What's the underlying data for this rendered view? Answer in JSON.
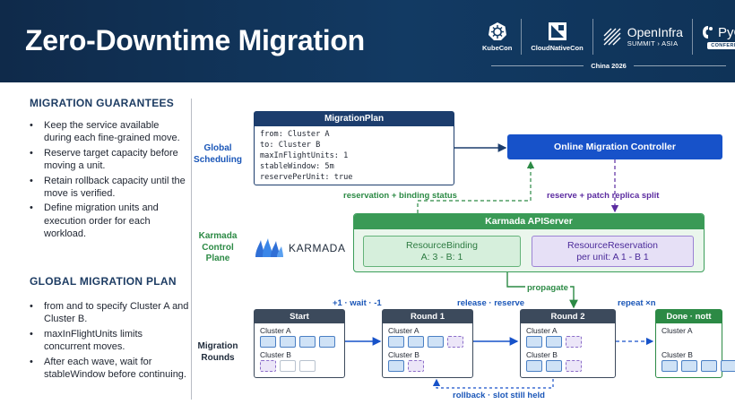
{
  "header": {
    "title": "Zero-Downtime Migration",
    "logos": {
      "kubecon": "KubeCon",
      "cloudnativecon": "CloudNativeCon",
      "openinfra_name": "OpenInfra",
      "openinfra_sub": "SUMMIT › ASIA",
      "pycon_name": "PyCon",
      "pycon_sub": "CONFERENCE",
      "event": "China 2026"
    }
  },
  "left": {
    "guarantees": {
      "heading": "MIGRATION GUARANTEES",
      "items": [
        "Keep the service available during each fine-grained move.",
        "Reserve target capacity before moving a unit.",
        "Retain rollback capacity until the move is verified.",
        "Define migration units and execution order for each workload."
      ]
    },
    "plan": {
      "heading": "GLOBAL MIGRATION PLAN",
      "items": [
        "from and to specify Cluster A and Cluster B.",
        "maxInFlightUnits limits concurrent moves.",
        "After each wave, wait for stableWindow before continuing."
      ]
    }
  },
  "diagram": {
    "rows": {
      "global": [
        "Global",
        "Scheduling"
      ],
      "karmada": [
        "Karmada",
        "Control",
        "Plane"
      ],
      "rounds": [
        "Migration",
        "Rounds"
      ]
    },
    "migration_plan": {
      "title": "MigrationPlan",
      "lines": [
        "from: Cluster A",
        "to: Cluster B",
        "maxInFlightUnits: 1",
        "stableWindow: 5m",
        "reservePerUnit: true"
      ]
    },
    "controller": "Online Migration Controller",
    "edges": {
      "reservation_status": "reservation + binding status",
      "reserve_patch": "reserve + patch replica split",
      "propagate": "propagate",
      "plus_wait_minus": "+1 · wait · -1",
      "release_reserve": "release · reserve",
      "repeat": "repeat ×n",
      "rollback": "rollback · slot still held"
    },
    "apiserver": {
      "title": "Karmada APIServer",
      "binding": {
        "name": "ResourceBinding",
        "value": "A: 3 - B: 1"
      },
      "reservation": {
        "name": "ResourceReservation",
        "value": "per unit: A 1 - B 1"
      }
    },
    "karmada_logo": "KARMADA",
    "rounds": [
      {
        "title": "Start",
        "cluster_a": "Cluster A",
        "cluster_b": "Cluster B",
        "a_slots": [
          "blue",
          "blue",
          "blue",
          "blue"
        ],
        "b_slots": [
          "purple",
          "empty",
          "empty"
        ]
      },
      {
        "title": "Round 1",
        "cluster_a": "Cluster A",
        "cluster_b": "Cluster B",
        "a_slots": [
          "blue",
          "blue",
          "blue",
          "purple"
        ],
        "b_slots": [
          "blue",
          "purple"
        ]
      },
      {
        "title": "Round 2",
        "cluster_a": "Cluster A",
        "cluster_b": "Cluster B",
        "a_slots": [
          "blue",
          "blue",
          "purple"
        ],
        "b_slots": [
          "blue",
          "blue",
          "purple"
        ]
      },
      {
        "title": "Done · nott",
        "cluster_a": "Cluster A",
        "cluster_b": "Cluster B",
        "a_slots": [],
        "b_slots": [
          "blue",
          "blue",
          "blue",
          "blue"
        ]
      }
    ]
  },
  "colors": {
    "header_bg": "#123a63",
    "blue_accent": "#1752c9",
    "green_accent": "#2c8a45",
    "purple_accent": "#5b2ba0",
    "navy": "#1c3d6d"
  }
}
